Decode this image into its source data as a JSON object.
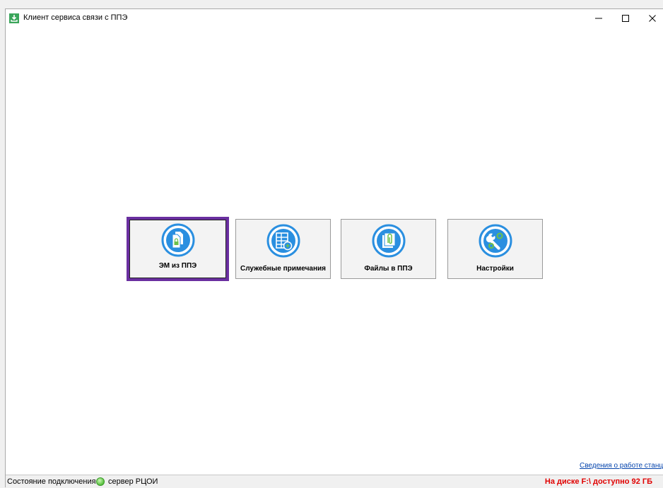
{
  "window": {
    "title": "Клиент сервиса связи с ППЭ",
    "app_icon": "download-tray-icon",
    "controls": {
      "minimize": "—",
      "maximize": "☐",
      "close": "✕"
    }
  },
  "tiles": [
    {
      "label": "ЭМ из ППЭ",
      "icon": "encrypted-documents-icon",
      "selected": true
    },
    {
      "label": "Служебные примечания",
      "icon": "table-add-icon",
      "selected": false
    },
    {
      "label": "Файлы в ППЭ",
      "icon": "attached-file-icon",
      "selected": false
    },
    {
      "label": "Настройки",
      "icon": "settings-tools-icon",
      "selected": false
    }
  ],
  "link": {
    "label": "Сведения о работе станции"
  },
  "status": {
    "connection_label": "Состояние подключения:",
    "server": "сервер РЦОИ",
    "disk": "На диске F:\\ доступно 92 ГБ",
    "disk_color": "#e00000",
    "connection_color": "#58c03e"
  },
  "colors": {
    "accent": "#2a8fe0",
    "selected_border": "#6a2fa0",
    "icon_green": "#6cc04a"
  }
}
